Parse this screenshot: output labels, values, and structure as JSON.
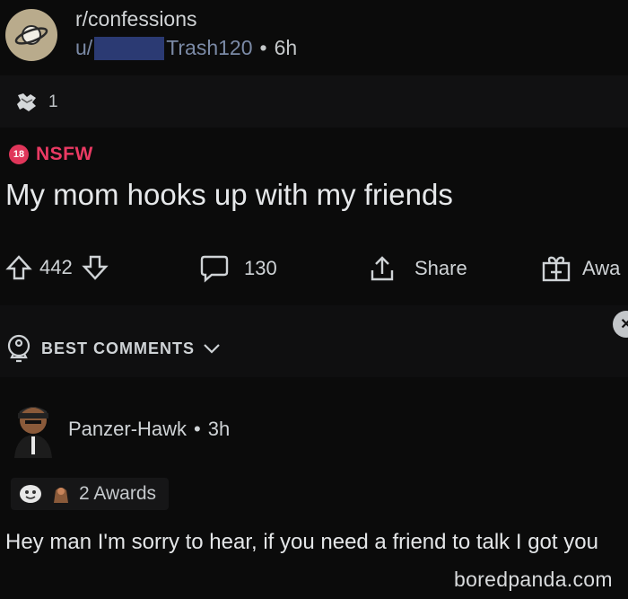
{
  "header": {
    "subreddit": "r/confessions",
    "user_prefix": "u/",
    "user_suffix": "Trash120",
    "separator": "•",
    "post_age": "6h"
  },
  "post": {
    "award_count": "1",
    "nsfw_badge": "18",
    "nsfw_label": "NSFW",
    "title": "My mom hooks up with my friends"
  },
  "actions": {
    "score": "442",
    "comments": "130",
    "share": "Share",
    "award": "Awa"
  },
  "sort": {
    "label": "BEST COMMENTS"
  },
  "comment": {
    "author": "Panzer-Hawk",
    "separator": "•",
    "age": "3h",
    "awards": "2 Awards",
    "body": "Hey man I'm sorry to hear, if you need a friend to talk I got you"
  },
  "watermark": "boredpanda.com",
  "colors": {
    "background": "#0b0b0b",
    "nsfw": "#ea3a63",
    "username": "#7b8aa6"
  },
  "icons": [
    "planet-icon",
    "award-hands-icon",
    "upvote-icon",
    "downvote-icon",
    "comment-bubble-icon",
    "share-icon",
    "gift-icon",
    "sort-rocket-icon",
    "chevron-down-icon",
    "close-icon"
  ]
}
